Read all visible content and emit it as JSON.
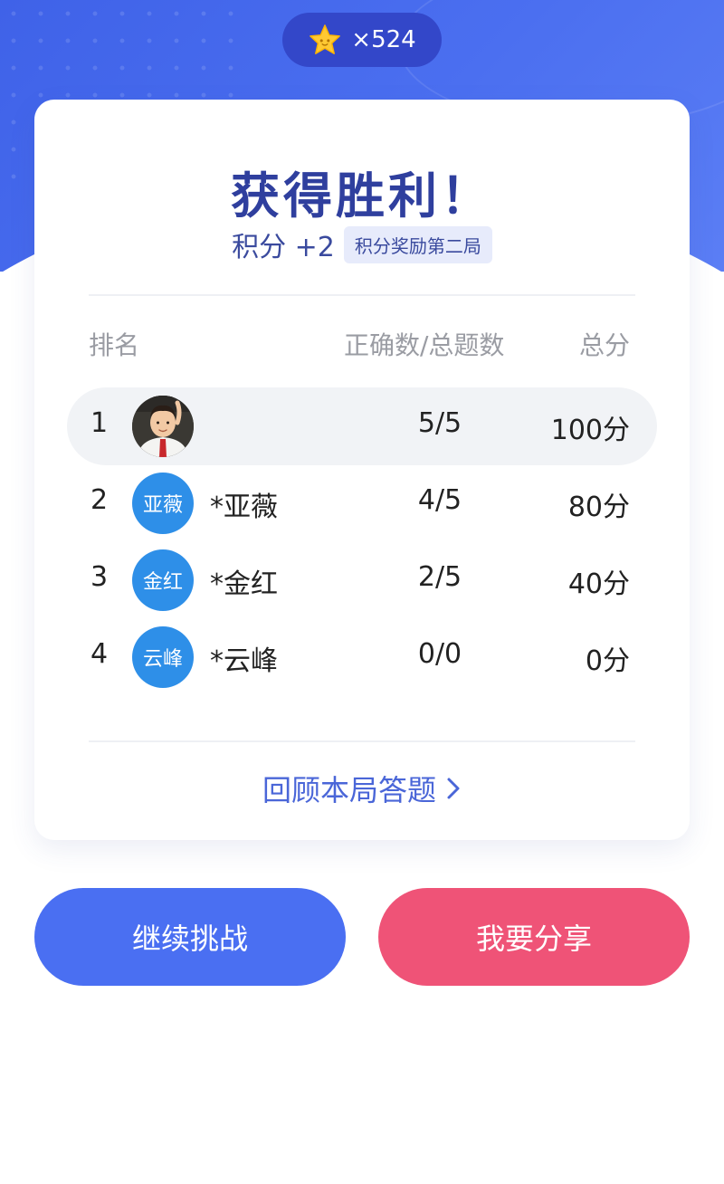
{
  "header": {
    "star_count": "×524"
  },
  "result": {
    "title": "获得胜利！",
    "score_text": "积分 +2",
    "score_tag": "积分奖励第二局"
  },
  "table": {
    "headers": {
      "rank": "排名",
      "ratio": "正确数/总题数",
      "total": "总分"
    },
    "rows": [
      {
        "rank": "1",
        "avatar_text": "",
        "name": "",
        "ratio": "5/5",
        "total": "100分"
      },
      {
        "rank": "2",
        "avatar_text": "亚薇",
        "name": "*亚薇",
        "ratio": "4/5",
        "total": "80分"
      },
      {
        "rank": "3",
        "avatar_text": "金红",
        "name": "*金红",
        "ratio": "2/5",
        "total": "40分"
      },
      {
        "rank": "4",
        "avatar_text": "云峰",
        "name": "*云峰",
        "ratio": "0/0",
        "total": "0分"
      }
    ]
  },
  "review_label": "回顾本局答题",
  "buttons": {
    "continue": "继续挑战",
    "share": "我要分享"
  },
  "colors": {
    "primary": "#4a6ff2",
    "share": "#ef5377",
    "title": "#2f3f9e",
    "avatar": "#2e8fe8",
    "star": "#ffc933"
  },
  "icons": {
    "star": "star-icon",
    "chevron": "chevron-right-icon",
    "user_photo": "user-photo-avatar"
  }
}
